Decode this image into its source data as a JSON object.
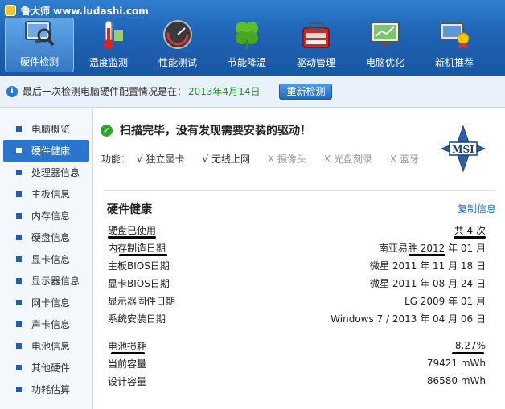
{
  "app": {
    "title": "鲁大师 www.ludashi.com"
  },
  "toolbar": [
    {
      "label": "硬件检测",
      "icon": "monitor-magnifier-icon",
      "active": true
    },
    {
      "label": "温度监测",
      "icon": "thermometer-icon",
      "active": false
    },
    {
      "label": "性能测试",
      "icon": "speedometer-icon",
      "active": false
    },
    {
      "label": "节能降温",
      "icon": "clover-icon",
      "active": false
    },
    {
      "label": "驱动管理",
      "icon": "toolbox-icon",
      "active": false
    },
    {
      "label": "电脑优化",
      "icon": "screen-chart-icon",
      "active": false
    },
    {
      "label": "新机推荐",
      "icon": "pc-award-icon",
      "active": false
    }
  ],
  "infobar": {
    "text": "最后一次检测电脑硬件配置情况是在：",
    "date": "2013年4月14日",
    "button": "重新检测"
  },
  "sidebar": [
    {
      "label": "电脑概览"
    },
    {
      "label": "硬件健康",
      "active": true
    },
    {
      "label": "处理器信息"
    },
    {
      "label": "主板信息"
    },
    {
      "label": "内存信息"
    },
    {
      "label": "硬盘信息"
    },
    {
      "label": "显卡信息"
    },
    {
      "label": "显示器信息"
    },
    {
      "label": "网卡信息"
    },
    {
      "label": "声卡信息"
    },
    {
      "label": "电池信息"
    },
    {
      "label": "其他硬件"
    },
    {
      "label": "功耗估算"
    }
  ],
  "scan": {
    "message": "扫描完毕，没有发现需要安装的驱动！"
  },
  "features": {
    "label": "功能：",
    "items": [
      {
        "text": "√ 独立显卡",
        "on": true
      },
      {
        "text": "√ 无线上网",
        "on": true
      },
      {
        "text": "X 摄像头",
        "on": false
      },
      {
        "text": "X 光盘刻录",
        "on": false
      },
      {
        "text": "X 蓝牙",
        "on": false
      }
    ]
  },
  "brand": {
    "logo_text": "MSI"
  },
  "health": {
    "title": "硬件健康",
    "copy": "复制信息",
    "group1": [
      {
        "k": "硬盘已使用",
        "v": "共 4 次"
      },
      {
        "k": "内存制造日期",
        "v": "南亚易胜 2012 年 01 月"
      },
      {
        "k": "主板BIOS日期",
        "v": "微星 2011 年 11 月 18 日"
      },
      {
        "k": "显卡BIOS日期",
        "v": "微星 2011 年 08 月 24 日"
      },
      {
        "k": "显示器固件日期",
        "v": "LG 2009 年 01 月"
      },
      {
        "k": "系统安装日期",
        "v": "Windows 7 / 2013 年 04 月 06 日"
      }
    ],
    "group2": [
      {
        "k": "电池损耗",
        "v": "8.27%"
      },
      {
        "k": "当前容量",
        "v": "79421 mWh"
      },
      {
        "k": "设计容量",
        "v": "86580 mWh"
      }
    ]
  },
  "colors": {
    "header": "#1f63b4",
    "accent": "#2a76cc",
    "date": "#1a9a1a",
    "link": "#1e6fd1"
  }
}
